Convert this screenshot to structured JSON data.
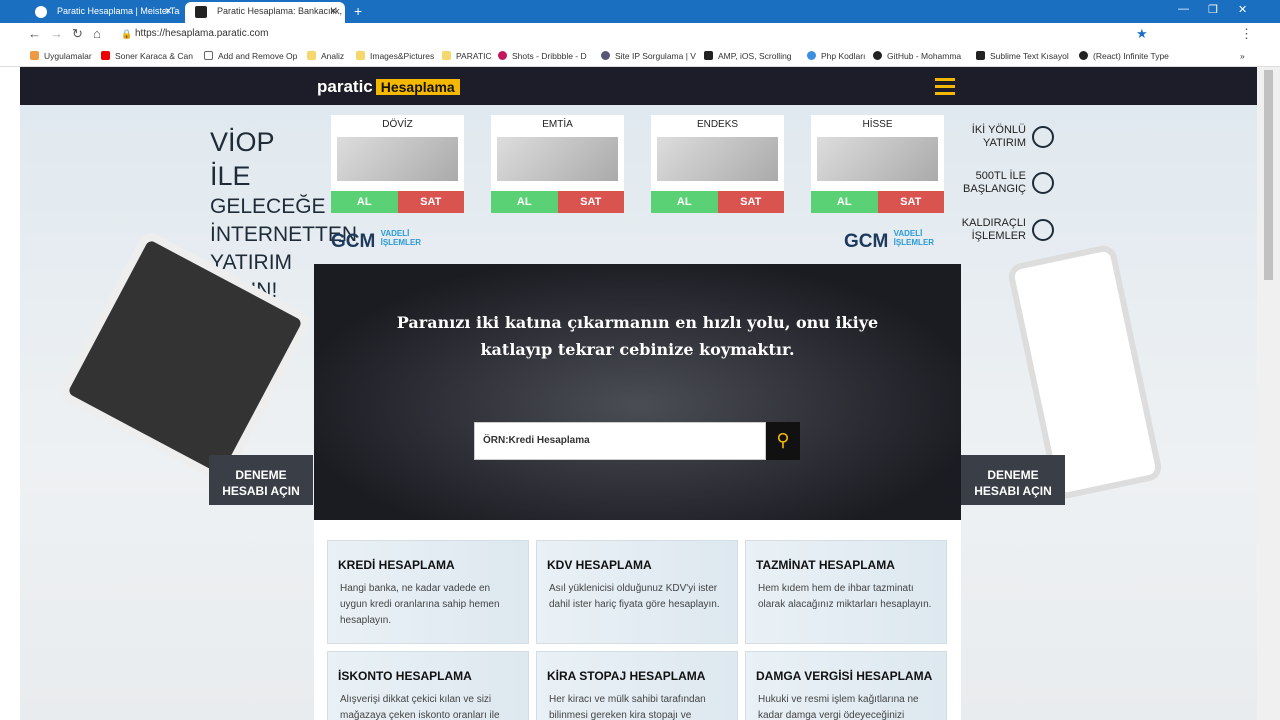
{
  "browser": {
    "tabs": [
      {
        "title": "Paratic Hesaplama | MeisterTask"
      },
      {
        "title": "Paratic Hesaplama: Bankacılık, S"
      }
    ],
    "url": "https://hesaplama.paratic.com",
    "bookmarks": [
      "Uygulamalar",
      "Soner Karaca & Can",
      "Add and Remove Op",
      "Analiz",
      "Images&Pictures",
      "PARATIC",
      "Shots - Dribbble - D",
      "Site IP Sorgulama | V",
      "AMP, iOS, Scrolling",
      "Php Kodları",
      "GitHub - Mohamma",
      "Sublime Text Kısayol",
      "(React) Infinite Type"
    ]
  },
  "header": {
    "logo_main": "paratic",
    "logo_tag": "Hesaplama"
  },
  "viop": [
    "VİOP İLE",
    "GELECEĞE",
    "İNTERNETTEN",
    "YATIRIM YAPIN!"
  ],
  "markets": [
    {
      "name": "DÖVİZ"
    },
    {
      "name": "EMTİA"
    },
    {
      "name": "ENDEKS"
    },
    {
      "name": "HİSSE"
    }
  ],
  "buy": "AL",
  "sell": "SAT",
  "gcm": {
    "name": "GCM",
    "tag1": "VADELİ",
    "tag2": "İŞLEMLER"
  },
  "features": [
    {
      "l1": "İKİ YÖNLÜ",
      "l2": "YATIRIM"
    },
    {
      "l1": "500TL İLE",
      "l2": "BAŞLANGIÇ"
    },
    {
      "l1": "KALDIRAÇLI",
      "l2": "İŞLEMLER"
    }
  ],
  "hero": {
    "line1": "Paranızı iki katına çıkarmanın en hızlı yolu, onu ikiye",
    "line2": "katlayıp tekrar cebinize koymaktır.",
    "search_placeholder": "ÖRN:Kredi Hesaplama"
  },
  "demo": {
    "l1": "DENEME",
    "l2": "HESABI AÇIN"
  },
  "cards": [
    {
      "title": "KREDİ HESAPLAMA",
      "desc": "Hangi banka, ne kadar vadede en uygun kredi oranlarına sahip hemen hesaplayın."
    },
    {
      "title": "KDV HESAPLAMA",
      "desc": "Asıl yüklenicisi olduğunuz KDV'yi ister dahil ister hariç fiyata göre hesaplayın."
    },
    {
      "title": "TAZMİNAT HESAPLAMA",
      "desc": "Hem kıdem hem de ihbar tazminatı olarak alacağınız miktarları hesaplayın."
    },
    {
      "title": "İSKONTO HESAPLAMA",
      "desc": "Alışverişi dikkat çekici kılan ve sizi mağazaya çeken iskonto oranları ile"
    },
    {
      "title": "KİRA STOPAJ HESAPLAMA",
      "desc": "Her kiracı ve mülk sahibi tarafından bilinmesi gereken kira stopajı ve"
    },
    {
      "title": "DAMGA VERGİSİ HESAPLAMA",
      "desc": "Hukuki ve resmi işlem kağıtlarına ne kadar damga vergi ödeyeceğinizi"
    }
  ]
}
